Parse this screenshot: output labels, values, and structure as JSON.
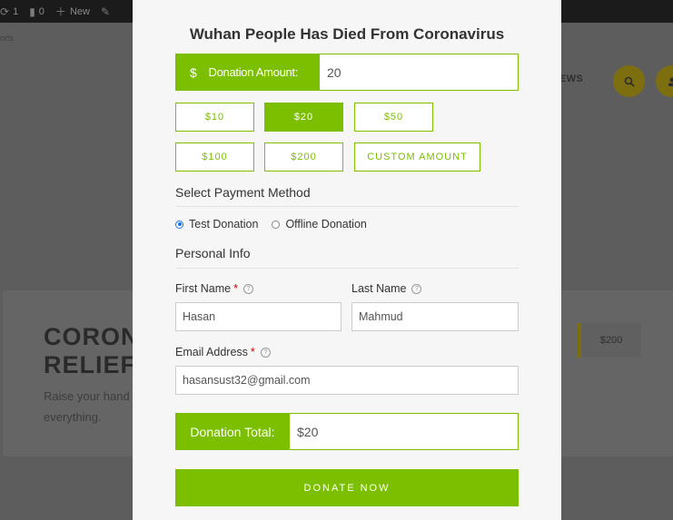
{
  "adminbar": {
    "comments_count": "1",
    "updates_count": "0",
    "new_label": "New"
  },
  "background": {
    "breadcrumb": "orts",
    "menu_item": "EWS",
    "card_title_line1": "CORON",
    "card_title_line2": "RELIEF",
    "card_sub_line1": "Raise your hand",
    "card_sub_line2": "everything.",
    "card_amount": "$200"
  },
  "form": {
    "title": "Wuhan People Has Died From Coronavirus",
    "currency_symbol": "$",
    "amount_label": "Donation Amount:",
    "amount_value": "20",
    "levels": [
      "$10",
      "$20",
      "$50",
      "$100",
      "$200",
      "CUSTOM AMOUNT"
    ],
    "selected_level": "$20",
    "payment_heading": "Select Payment Method",
    "gateways": [
      "Test Donation",
      "Offline Donation"
    ],
    "selected_gateway": "Test Donation",
    "personal_heading": "Personal Info",
    "first_name_label": "First Name",
    "first_name_value": "Hasan",
    "last_name_label": "Last Name",
    "last_name_value": "Mahmud",
    "email_label": "Email Address",
    "email_value": "hasansust32@gmail.com",
    "required_mark": "*",
    "help_mark": "?",
    "total_label": "Donation Total:",
    "total_value": "$20",
    "donate_button": "DONATE NOW"
  },
  "colors": {
    "accent": "#7bbf00",
    "overlay": "#5d5d5d",
    "adminbar": "#1b1b1b"
  }
}
